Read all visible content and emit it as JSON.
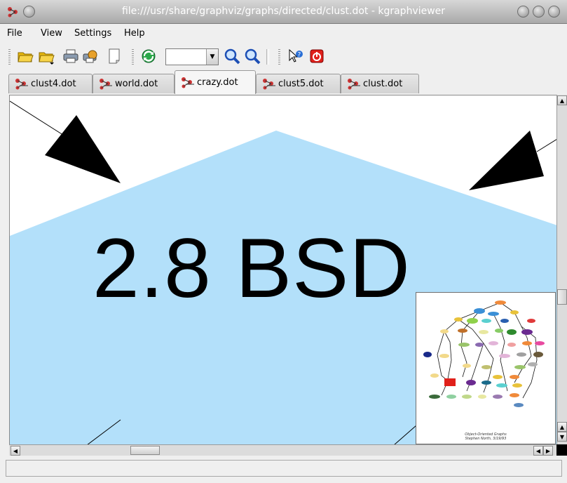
{
  "window": {
    "title": "file:///usr/share/graphviz/graphs/directed/clust.dot - kgraphviewer"
  },
  "menubar": {
    "items": [
      {
        "label": "File",
        "name": "menu-file"
      },
      {
        "label": "View",
        "name": "menu-view"
      },
      {
        "label": "Settings",
        "name": "menu-settings"
      },
      {
        "label": "Help",
        "name": "menu-help"
      }
    ]
  },
  "toolbar": {
    "zoom_value": "",
    "icons": [
      "open-folder-icon",
      "open-recent-icon",
      "print-icon",
      "print-preview-icon",
      "new-page-icon",
      "reload-icon",
      "zoom-in-icon",
      "zoom-out-icon",
      "whats-this-icon",
      "quit-icon"
    ]
  },
  "tabs": [
    {
      "label": "clust4.dot",
      "active": false
    },
    {
      "label": "world.dot",
      "active": false
    },
    {
      "label": "crazy.dot",
      "active": true
    },
    {
      "label": "clust5.dot",
      "active": false
    },
    {
      "label": "clust.dot",
      "active": false
    }
  ],
  "graph": {
    "node_label": "2.8 BSD",
    "node_fill": "#b3e0fa",
    "edge_color": "#000000"
  },
  "birdseye": {
    "caption_line1": "Object-Oriented Graphs",
    "caption_line2": "Stephen North, 3/19/93"
  },
  "colors": {
    "title_text": "#ffffff",
    "accent_red": "#e0201a",
    "reload_green": "#2aa84a"
  }
}
